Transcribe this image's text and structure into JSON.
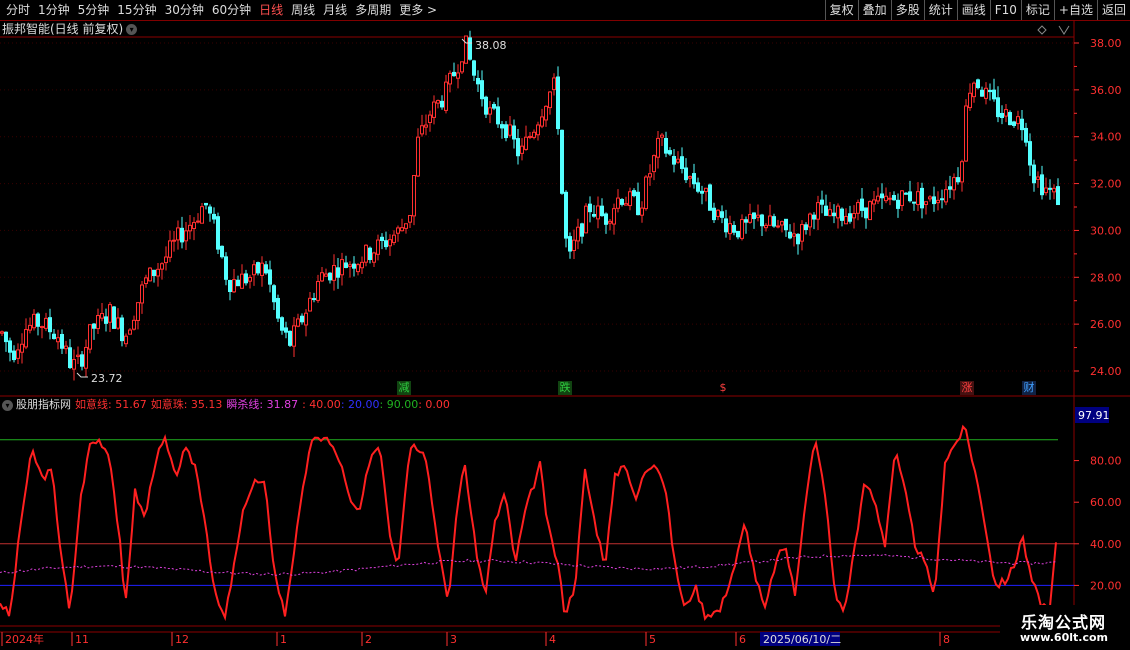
{
  "toolbar": {
    "periods": [
      "分时",
      "1分钟",
      "5分钟",
      "15分钟",
      "30分钟",
      "60分钟",
      "日线",
      "周线",
      "月线",
      "多周期",
      "更多 >"
    ],
    "active_period": "日线",
    "right_buttons": [
      "复权",
      "叠加",
      "多股",
      "统计",
      "画线",
      "F10",
      "标记",
      "+自选",
      "返回"
    ]
  },
  "main": {
    "title": "振邦智能(日线 前复权)",
    "high_label": "38.08",
    "low_label": "23.72",
    "y_ticks": [
      "38.00",
      "36.00",
      "34.00",
      "32.00",
      "30.00",
      "28.00",
      "26.00",
      "24.00"
    ],
    "events": [
      {
        "label": "减",
        "color": "#2ecc40",
        "bg": "#114411"
      },
      {
        "label": "跌",
        "color": "#2ecc40",
        "bg": "#114411"
      },
      {
        "label": "$",
        "color": "#ff4040",
        "bg": "#000000"
      },
      {
        "label": "涨",
        "color": "#ff4040",
        "bg": "#441111"
      },
      {
        "label": "财",
        "color": "#40a0ff",
        "bg": "#112244"
      }
    ]
  },
  "indicator": {
    "name": "股朋指标网",
    "line1_label": "如意线: 51.67",
    "line2_label": "如意珠: 35.13",
    "line3_label": "瞬杀线: 31.87",
    "level_labels": [
      ": 40.00",
      ": 20.00",
      ": 90.00",
      ": 0.00"
    ],
    "current_value": "97.91",
    "y_ticks": [
      "80.00",
      "60.00",
      "40.00",
      "20.00"
    ],
    "colors": {
      "line1": "#ff2020",
      "line3": "#e040e0",
      "level40": "#c03030",
      "level20": "#2020ff",
      "level90": "#20b020"
    }
  },
  "xaxis": {
    "labels": [
      "2024年",
      "11",
      "12",
      "1",
      "2",
      "3",
      "4",
      "5",
      "6",
      "8"
    ],
    "highlight_date": "2025/06/10/二"
  },
  "watermark": {
    "title": "乐淘公式网",
    "url": "www.60lt.com"
  }
}
